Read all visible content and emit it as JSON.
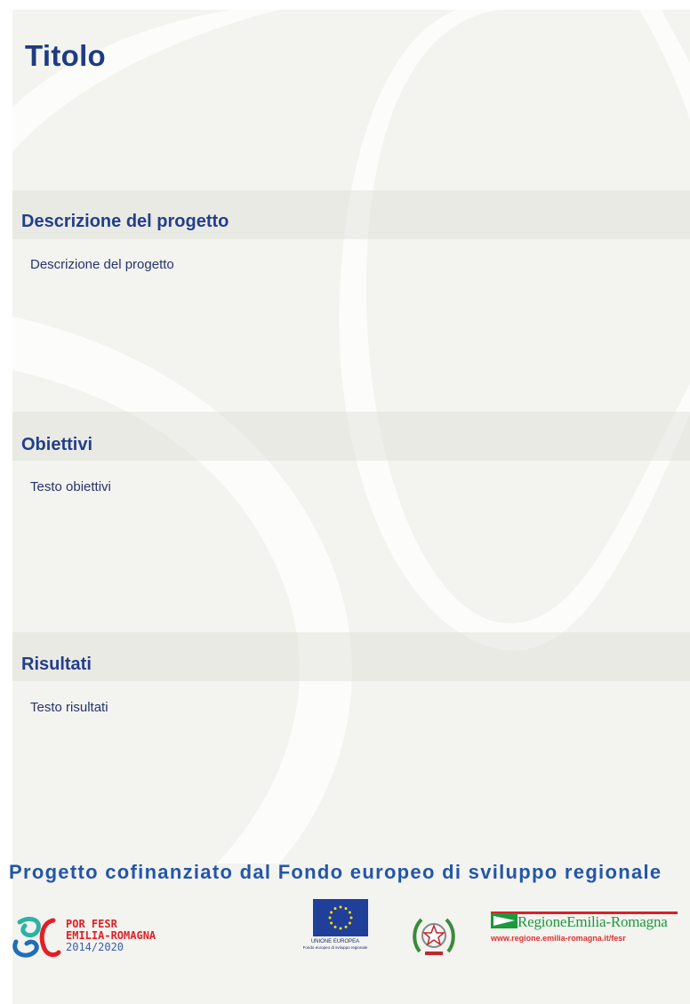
{
  "document": {
    "title": "Titolo",
    "sections": [
      {
        "heading": "Descrizione del progetto",
        "body": "Descrizione del progetto"
      },
      {
        "heading": "Obiettivi",
        "body": "Testo obiettivi"
      },
      {
        "heading": "Risultati",
        "body": "Testo risultati"
      }
    ]
  },
  "footer": {
    "cofinancing_text": "Progetto cofinanziato dal Fondo europeo di sviluppo regionale",
    "logos": {
      "por_fesr": {
        "line1": "POR FESR",
        "line2": "EMILIA-ROMAGNA",
        "line3": "2014/2020"
      },
      "eu": {
        "caption": "UNIONE EUROPEA",
        "subcaption": "Fondo europeo di sviluppo regionale"
      },
      "region": {
        "name": "RegioneEmilia-Romagna",
        "url": "www.regione.emilia-romagna.it/fesr"
      }
    }
  },
  "colors": {
    "heading_blue": "#233e8b",
    "footer_blue": "#2356a8",
    "background": "#f3f3ef",
    "por_red": "#e21f26",
    "region_green": "#1a9a3c"
  }
}
